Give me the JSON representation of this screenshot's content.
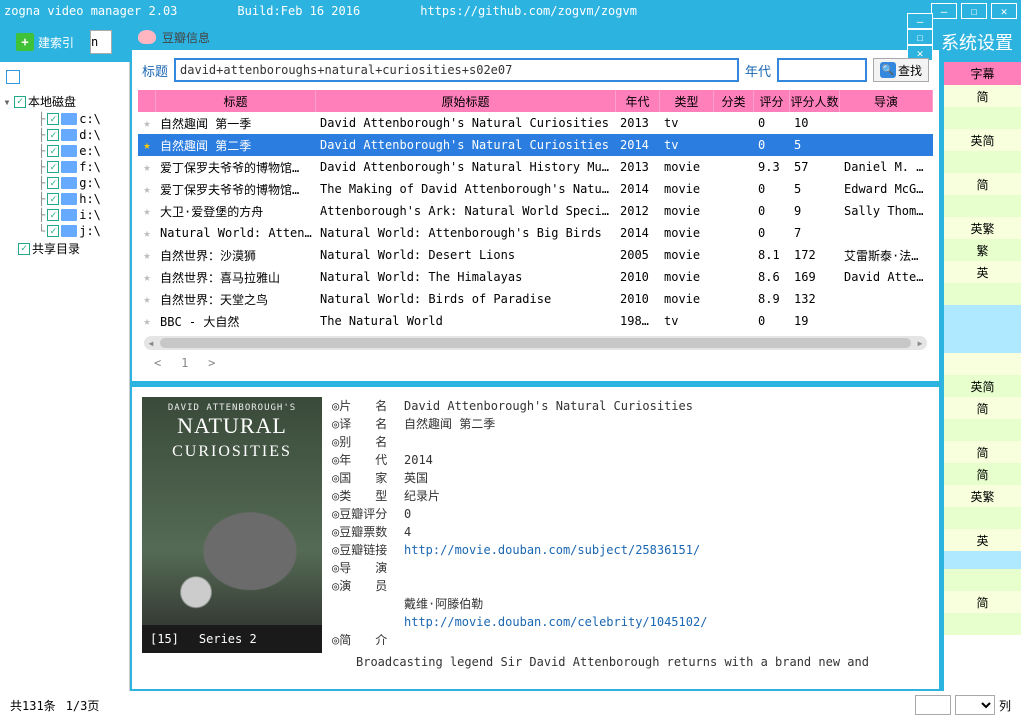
{
  "app": {
    "title": "zogna video manager 2.03",
    "build": "Build:Feb 16 2016",
    "url": "https://github.com/zogvm/zogvm"
  },
  "toolbar": {
    "build_index": "建索引",
    "sys_settings": "系统设置",
    "n_field": "n"
  },
  "tree": {
    "root": "本地磁盘",
    "share": "共享目录",
    "drives": [
      "c:\\",
      "d:\\",
      "e:\\",
      "f:\\",
      "g:\\",
      "h:\\",
      "i:\\",
      "j:\\"
    ]
  },
  "douban": {
    "window_title": "豆瓣信息",
    "label_title": "标题",
    "search_value": "david+attenboroughs+natural+curiosities+s02e07",
    "label_year": "年代",
    "find_btn": "查找",
    "columns": {
      "title": "标题",
      "orig": "原始标题",
      "year": "年代",
      "type": "类型",
      "cat": "分类",
      "rating": "评分",
      "votes": "评分人数",
      "director": "导演"
    },
    "rows": [
      {
        "star": false,
        "title": "自然趣闻 第一季",
        "orig": "David Attenborough's Natural Curiosities",
        "year": "2013",
        "type": "tv",
        "cat": "",
        "rating": "0",
        "votes": "10",
        "director": "",
        "sel": false
      },
      {
        "star": true,
        "title": "自然趣闻 第二季",
        "orig": "David Attenborough's Natural Curiosities",
        "year": "2014",
        "type": "tv",
        "cat": "",
        "rating": "0",
        "votes": "5",
        "director": "",
        "sel": true
      },
      {
        "star": false,
        "title": "爱丁保罗夫爷爷的博物馆…",
        "orig": "David Attenborough's Natural History Museum Alive",
        "year": "2013",
        "type": "movie",
        "cat": "",
        "rating": "9.3",
        "votes": "57",
        "director": "Daniel M. Smi",
        "sel": false
      },
      {
        "star": false,
        "title": "爱丁保罗夫爷爷的博物馆…",
        "orig": "The Making of David Attenborough's Natural Histo…",
        "year": "2014",
        "type": "movie",
        "cat": "",
        "rating": "0",
        "votes": "5",
        "director": "Edward McGown",
        "sel": false
      },
      {
        "star": false,
        "title": "大卫·爱登堡的方舟",
        "orig": "Attenborough's Ark: Natural World Special",
        "year": "2012",
        "type": "movie",
        "cat": "",
        "rating": "0",
        "votes": "9",
        "director": "Sally Thomson",
        "sel": false
      },
      {
        "star": false,
        "title": "Natural World: Attenbor…",
        "orig": "Natural World: Attenborough's Big Birds",
        "year": "2014",
        "type": "movie",
        "cat": "",
        "rating": "0",
        "votes": "7",
        "director": "",
        "sel": false
      },
      {
        "star": false,
        "title": "自然世界：沙漠狮",
        "orig": "Natural World: Desert Lions",
        "year": "2005",
        "type": "movie",
        "cat": "",
        "rating": "8.1",
        "votes": "172",
        "director": "艾雷斯泰·法…",
        "sel": false
      },
      {
        "star": false,
        "title": "自然世界：喜马拉雅山",
        "orig": "Natural World: The Himalayas",
        "year": "2010",
        "type": "movie",
        "cat": "",
        "rating": "8.6",
        "votes": "169",
        "director": "David Attenbo",
        "sel": false
      },
      {
        "star": false,
        "title": "自然世界：天堂之鸟",
        "orig": "Natural World: Birds of Paradise",
        "year": "2010",
        "type": "movie",
        "cat": "",
        "rating": "8.9",
        "votes": "132",
        "director": "",
        "sel": false
      },
      {
        "star": false,
        "title": "BBC - 大自然",
        "orig": "The Natural World",
        "year": "198…",
        "type": "tv",
        "cat": "",
        "rating": "0",
        "votes": "19",
        "director": "",
        "sel": false
      }
    ],
    "pager_page": "1",
    "detail": {
      "poster_top": "DAVID ATTENBOROUGH'S",
      "poster_t1": "NATURAL",
      "poster_t2": "CURIOSITIES",
      "poster_series": "Series 2",
      "k_name": "◎片　　名",
      "v_name": "David Attenborough's Natural Curiosities",
      "k_trans": "◎译　　名",
      "v_trans": "自然趣闻 第二季",
      "k_alias": "◎别　　名",
      "v_alias": "",
      "k_year": "◎年　　代",
      "v_year": "2014",
      "k_country": "◎国　　家",
      "v_country": "英国",
      "k_genre": "◎类　　型",
      "v_genre": "纪录片",
      "k_rating": "◎豆瓣评分",
      "v_rating": "0",
      "k_votes": "◎豆瓣票数",
      "v_votes": "4",
      "k_link": "◎豆瓣链接",
      "v_link": "http://movie.douban.com/subject/25836151/",
      "k_director": "◎导　　演",
      "v_director": "",
      "k_cast": "◎演　　员",
      "v_cast_name": "戴维·阿滕伯勒",
      "v_cast_link": "http://movie.douban.com/celebrity/1045102/",
      "k_synopsis": "◎简　　介",
      "synopsis": "Broadcasting legend Sir David Attenborough returns with a brand new and exclusive second series of his award-winning David Attenborough's Natural Curiosities."
    }
  },
  "right": {
    "header": "字幕",
    "cells": [
      "简",
      "",
      "英简",
      "",
      "简",
      "",
      "英繁",
      "繁",
      "英",
      "",
      "",
      "英简",
      "简",
      "",
      "简",
      "简",
      "英繁",
      "",
      "英",
      "",
      "简",
      ""
    ]
  },
  "status": {
    "total": "共131条",
    "page": "1/3页",
    "list_label": "列"
  }
}
